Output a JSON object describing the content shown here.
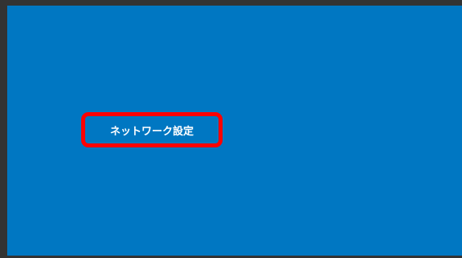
{
  "screen": {
    "background_color": "#0077c2",
    "frame_color": "#333333"
  },
  "menu": {
    "network_settings_label": "ネットワーク設定",
    "highlight_color": "#ff0000"
  }
}
